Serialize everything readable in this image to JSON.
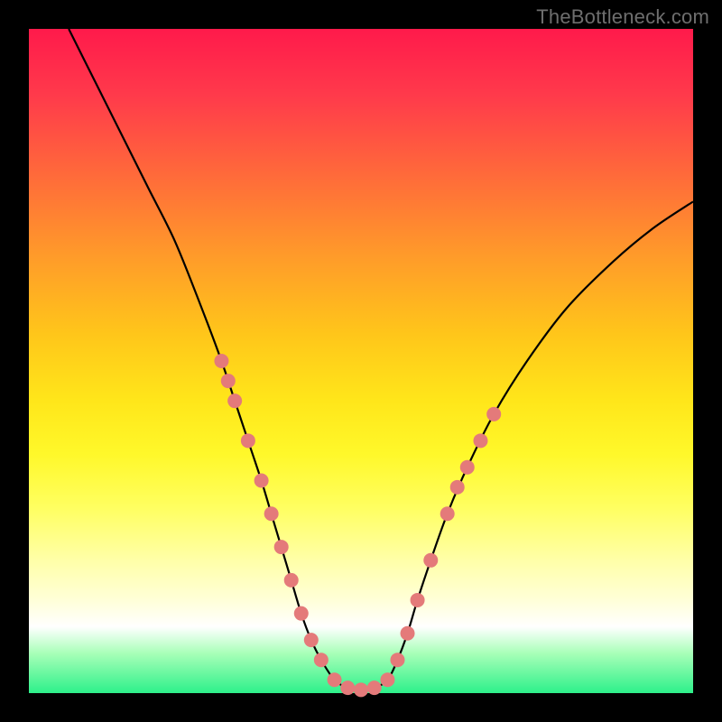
{
  "watermark_text": "TheBottleneck.com",
  "chart_data": {
    "type": "line",
    "title": "",
    "xlabel": "",
    "ylabel": "",
    "xlim": [
      0,
      100
    ],
    "ylim": [
      0,
      100
    ],
    "series": [
      {
        "name": "curve",
        "x": [
          6,
          10,
          14,
          18,
          22,
          26,
          29,
          31,
          33,
          35,
          36.5,
          38,
          39.5,
          41,
          42.5,
          44,
          46,
          48,
          50,
          52,
          54,
          55.5,
          57,
          58.5,
          60.5,
          63,
          66,
          70,
          75,
          81,
          88,
          94,
          100
        ],
        "y": [
          100,
          92,
          84,
          76,
          68,
          58,
          50,
          44,
          38,
          32,
          27,
          22,
          17,
          12,
          8,
          5,
          2,
          0.8,
          0.5,
          0.8,
          2,
          5,
          9,
          14,
          20,
          27,
          34,
          42,
          50,
          58,
          65,
          70,
          74
        ]
      }
    ],
    "markers": {
      "left_cluster": [
        {
          "x": 29,
          "y": 50
        },
        {
          "x": 30,
          "y": 47
        },
        {
          "x": 31,
          "y": 44
        },
        {
          "x": 33,
          "y": 38
        },
        {
          "x": 35,
          "y": 32
        },
        {
          "x": 36.5,
          "y": 27
        },
        {
          "x": 38,
          "y": 22
        },
        {
          "x": 39.5,
          "y": 17
        },
        {
          "x": 41,
          "y": 12
        },
        {
          "x": 42.5,
          "y": 8
        }
      ],
      "trough": [
        {
          "x": 44,
          "y": 5
        },
        {
          "x": 46,
          "y": 2
        },
        {
          "x": 48,
          "y": 0.8
        },
        {
          "x": 50,
          "y": 0.5
        },
        {
          "x": 52,
          "y": 0.8
        },
        {
          "x": 54,
          "y": 2
        },
        {
          "x": 55.5,
          "y": 5
        }
      ],
      "right_cluster": [
        {
          "x": 57,
          "y": 9
        },
        {
          "x": 58.5,
          "y": 14
        },
        {
          "x": 60.5,
          "y": 20
        },
        {
          "x": 63,
          "y": 27
        },
        {
          "x": 64.5,
          "y": 31
        },
        {
          "x": 66,
          "y": 34
        },
        {
          "x": 68,
          "y": 38
        },
        {
          "x": 70,
          "y": 42
        }
      ]
    },
    "annotations": []
  },
  "colors": {
    "curve": "#000000",
    "marker": "#e47a7a"
  }
}
